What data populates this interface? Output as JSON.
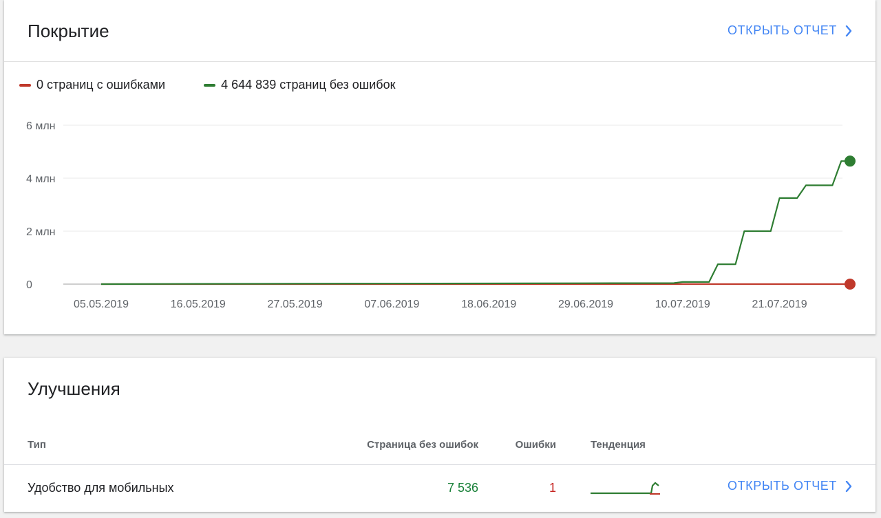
{
  "coverage": {
    "title": "Покрытие",
    "open_report": "ОТКРЫТЬ ОТЧЕТ",
    "legend": [
      {
        "label": "0 страниц с ошибками",
        "color": "#c0392b"
      },
      {
        "label": "4 644 839 страниц без ошибок",
        "color": "#2e7d32"
      }
    ]
  },
  "chart_data": {
    "type": "line",
    "ylim": [
      0,
      6000000
    ],
    "y_ticks": [
      {
        "value": 0,
        "label": "0"
      },
      {
        "value": 2000000,
        "label": "2 млн"
      },
      {
        "value": 4000000,
        "label": "4 млн"
      },
      {
        "value": 6000000,
        "label": "6 млн"
      }
    ],
    "x_tick_labels": [
      "05.05.2019",
      "16.05.2019",
      "27.05.2019",
      "07.06.2019",
      "18.06.2019",
      "29.06.2019",
      "10.07.2019",
      "21.07.2019"
    ],
    "grid": true,
    "series": [
      {
        "name": "0 страниц с ошибками",
        "color": "#c0392b",
        "points": [
          [
            "05.05.2019",
            0
          ],
          [
            "20.05.2019",
            0
          ],
          [
            "15.06.2019",
            0
          ],
          [
            "01.07.2019",
            0
          ],
          [
            "12.07.2019",
            0
          ],
          [
            "20.07.2019",
            0
          ],
          [
            "29.07.2019",
            0
          ]
        ]
      },
      {
        "name": "4 644 839 страниц без ошибок",
        "color": "#2e7d32",
        "points": [
          [
            "05.05.2019",
            0
          ],
          [
            "16.05.2019",
            10000
          ],
          [
            "27.05.2019",
            15000
          ],
          [
            "07.06.2019",
            20000
          ],
          [
            "18.06.2019",
            25000
          ],
          [
            "29.06.2019",
            35000
          ],
          [
            "09.07.2019",
            40000
          ],
          [
            "10.07.2019",
            80000
          ],
          [
            "13.07.2019",
            80000
          ],
          [
            "14.07.2019",
            750000
          ],
          [
            "16.07.2019",
            750000
          ],
          [
            "17.07.2019",
            2000000
          ],
          [
            "20.07.2019",
            2000000
          ],
          [
            "21.07.2019",
            3250000
          ],
          [
            "23.07.2019",
            3250000
          ],
          [
            "24.07.2019",
            3730000
          ],
          [
            "27.07.2019",
            3730000
          ],
          [
            "28.07.2019",
            4644839
          ],
          [
            "29.07.2019",
            4644839
          ]
        ]
      }
    ]
  },
  "enhancements": {
    "title": "Улучшения",
    "columns": {
      "type": "Тип",
      "valid": "Страница без ошибок",
      "errors": "Ошибки",
      "trend": "Тенденция"
    },
    "rows": [
      {
        "type": "Удобство для мобильных",
        "valid": "7 536",
        "errors": "1",
        "open_report": "ОТКРЫТЬ ОТЧЕТ"
      }
    ]
  }
}
